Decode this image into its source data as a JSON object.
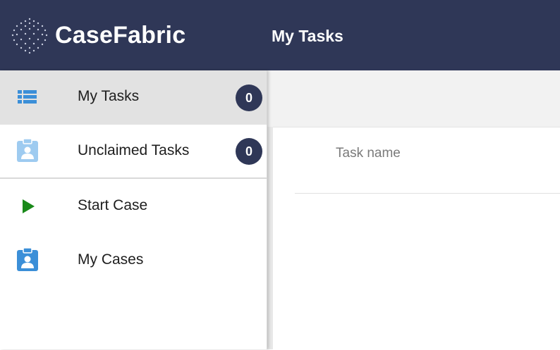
{
  "header": {
    "app_name": "CaseFabric",
    "page_title": "My Tasks",
    "bg_color": "#2f3757"
  },
  "sidebar": {
    "items": [
      {
        "label": "My Tasks",
        "icon": "list-icon",
        "badge": "0",
        "active": true
      },
      {
        "label": "Unclaimed Tasks",
        "icon": "clipboard-user-icon",
        "badge": "0",
        "active": false
      },
      {
        "label": "Start Case",
        "icon": "play-icon",
        "active": false
      },
      {
        "label": "My Cases",
        "icon": "clipboard-user-icon",
        "active": false
      }
    ]
  },
  "main": {
    "columns": [
      "Task name"
    ]
  },
  "colors": {
    "accent_blue": "#3b8fd8",
    "light_blue": "#9ecbf0",
    "start_green": "#1a8a1a",
    "badge_bg": "#2f3757"
  }
}
